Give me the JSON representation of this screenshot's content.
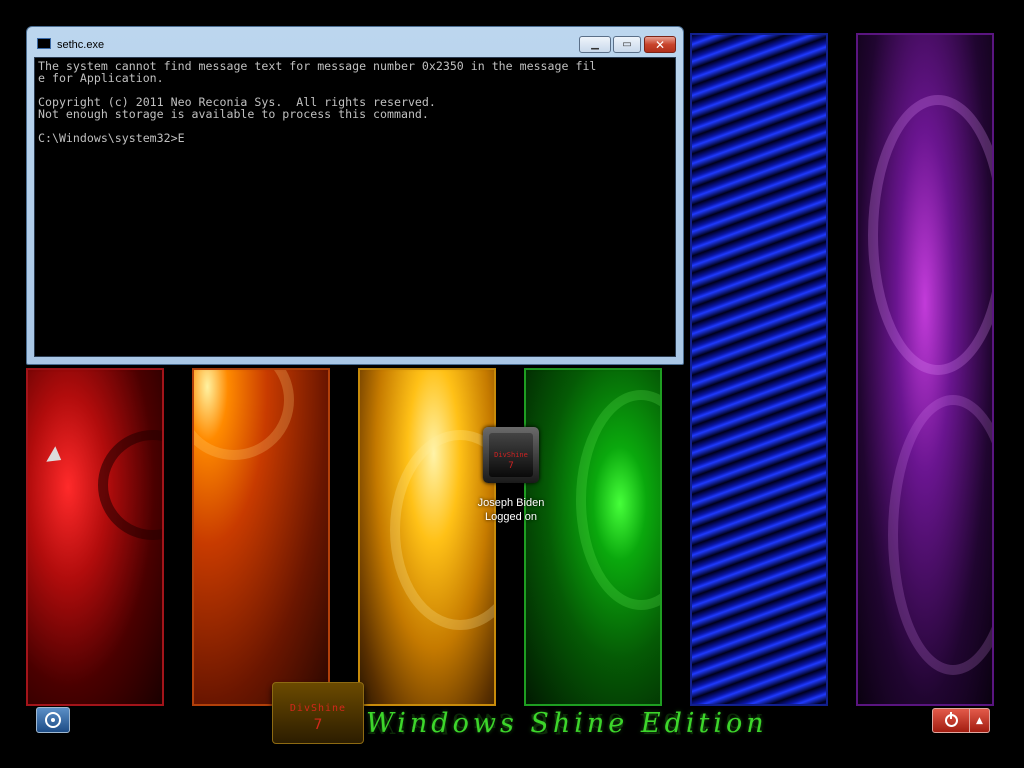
{
  "console": {
    "title": "sethc.exe",
    "lines": "The system cannot find message text for message number 0x2350 in the message fil\ne for Application.\n\nCopyright (c) 2011 Neo Reconia Sys.  All rights reserved.\nNot enough storage is available to process this command.\n\nC:\\Windows\\system32>E",
    "minimize_icon": "minimize-icon",
    "maximize_icon": "maximize-icon",
    "close_icon": "close-icon"
  },
  "user": {
    "name": "Joseph Biden",
    "status": "Logged on",
    "tile_label": "DivShine",
    "tile_number": "7"
  },
  "branding": {
    "logo_label": "DivShine",
    "logo_number": "7",
    "edition_text": "Windows Shine Edition",
    "edition_color": "#3dd62b"
  },
  "controls": {
    "ease_of_access_icon": "ease-of-access-icon",
    "shutdown_icon": "power-icon",
    "shutdown_options_icon": "chevron-up-icon"
  },
  "colors": {
    "panel_red": "#a3141a",
    "panel_orange": "#b2400a",
    "panel_yellow": "#c88b0a",
    "panel_green": "#1e9e21",
    "panel_blue": "#12208e",
    "panel_purple": "#5a1580",
    "shutdown": "#c0392b"
  }
}
